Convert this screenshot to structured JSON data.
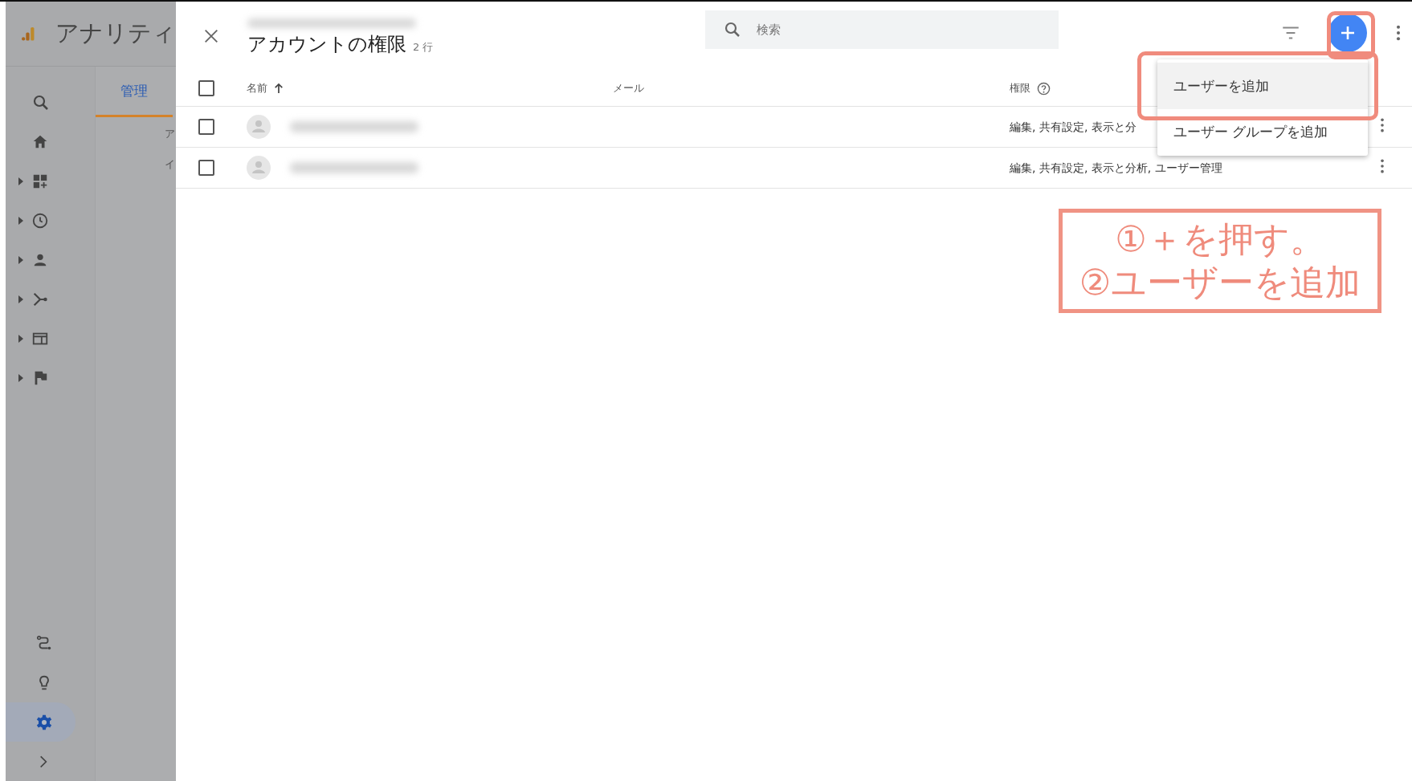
{
  "sidebar": {
    "app_title": "アナリティ",
    "nav_items": [
      {
        "kind": "search",
        "expandable": false,
        "selected": false
      },
      {
        "kind": "home",
        "expandable": false,
        "selected": false
      },
      {
        "kind": "dashboard",
        "expandable": true,
        "selected": false
      },
      {
        "kind": "clock",
        "expandable": true,
        "selected": false
      },
      {
        "kind": "person",
        "expandable": true,
        "selected": false
      },
      {
        "kind": "fork",
        "expandable": true,
        "selected": false
      },
      {
        "kind": "window",
        "expandable": true,
        "selected": false
      },
      {
        "kind": "flag",
        "expandable": true,
        "selected": false
      }
    ],
    "bottom_items": [
      {
        "kind": "route",
        "selected": false
      },
      {
        "kind": "bulb",
        "selected": false
      },
      {
        "kind": "gear",
        "selected": true
      },
      {
        "kind": "chevron",
        "selected": false
      }
    ],
    "tab": {
      "label": "管理",
      "selected": true
    },
    "items": [
      "ア",
      "イ"
    ]
  },
  "panel": {
    "title": "アカウントの権限",
    "row_count": "2 行",
    "search": {
      "placeholder": "検索"
    },
    "select_all": {
      "checked": false
    },
    "columns": [
      {
        "label": "名前",
        "sorted": true,
        "help": false
      },
      {
        "label": "メール",
        "sorted": false,
        "help": false
      },
      {
        "label": "権限",
        "sorted": false,
        "help": true
      }
    ],
    "rows": [
      {
        "checked": false,
        "permissions": "編集, 共有設定, 表示と分"
      },
      {
        "checked": false,
        "permissions": "編集, 共有設定, 表示と分析, ユーザー管理"
      }
    ]
  },
  "menu": {
    "items": [
      {
        "label": "ユーザーを追加",
        "selected": true
      },
      {
        "label": "ユーザー グループを追加",
        "selected": false
      }
    ]
  },
  "annotation": {
    "lines": [
      "①＋を押す。",
      "②ユーザーを追加"
    ]
  }
}
